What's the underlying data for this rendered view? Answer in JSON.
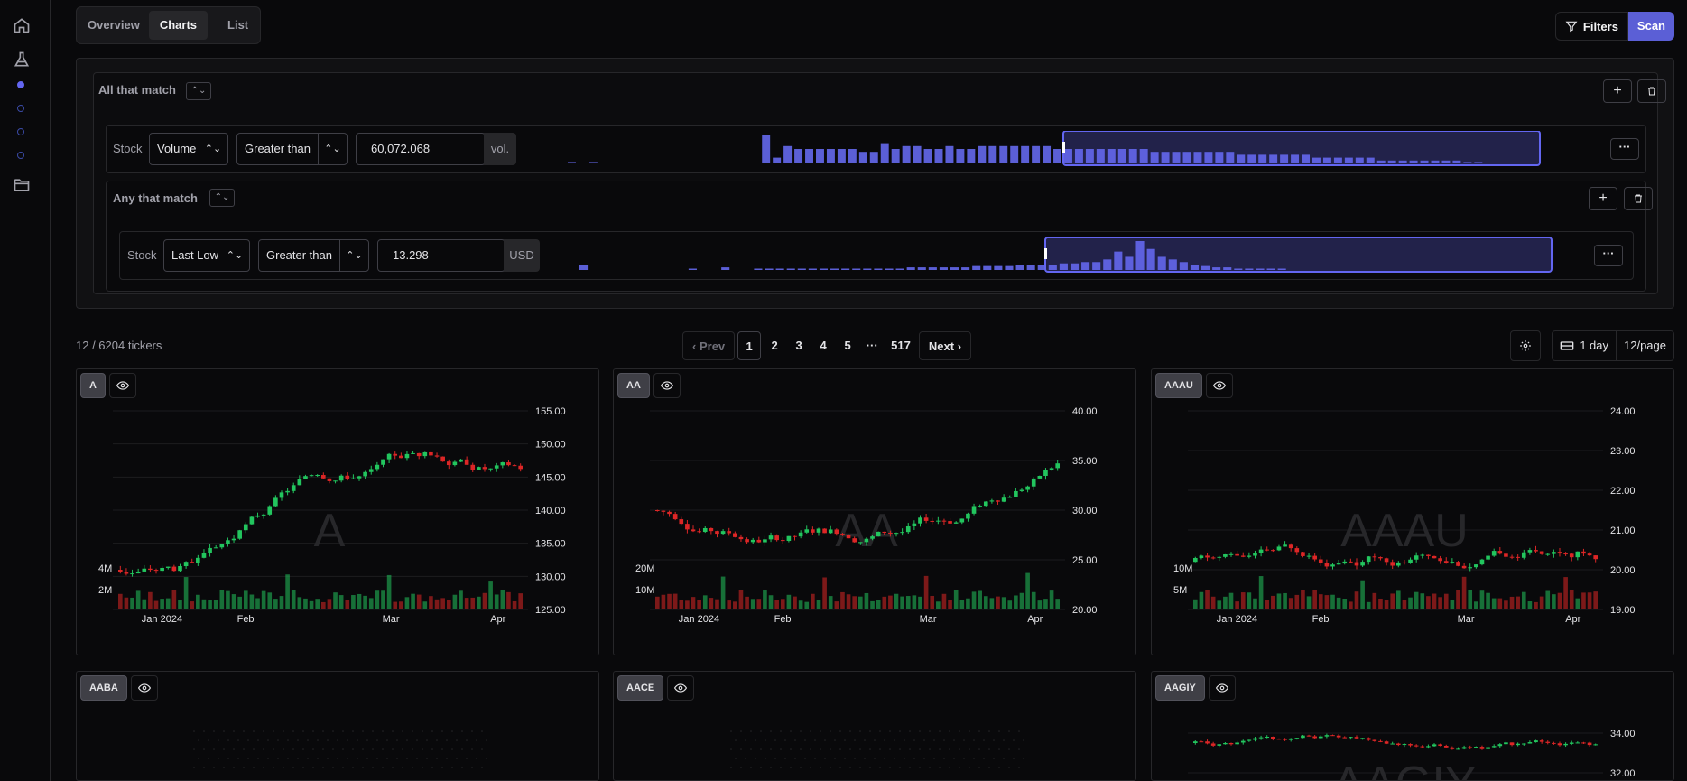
{
  "nav": {
    "icons": [
      "home-icon",
      "flask-icon",
      "folder-icon"
    ]
  },
  "tabs": [
    {
      "label": "Overview",
      "active": false
    },
    {
      "label": "Charts",
      "active": true
    },
    {
      "label": "List",
      "active": false
    }
  ],
  "toolbar": {
    "filters_label": "Filters",
    "scan_label": "Scan"
  },
  "filter_groups": {
    "outer": {
      "title": "All that match"
    },
    "rule1": {
      "scope": "Stock",
      "field": "Volume",
      "operator": "Greater than",
      "value": "60,072.068",
      "unit": "vol."
    },
    "inner": {
      "title": "Any that match"
    },
    "rule2": {
      "scope": "Stock",
      "field": "Last Low",
      "operator": "Greater than",
      "value": "13.298",
      "unit": "USD"
    },
    "hist1": [
      1,
      0,
      1,
      0,
      0,
      0,
      0,
      0,
      0,
      0,
      0,
      0,
      0,
      0,
      0,
      0,
      0,
      0,
      20,
      4,
      12,
      10,
      10,
      10,
      10,
      10,
      10,
      8,
      8,
      14,
      10,
      12,
      12,
      10,
      10,
      12,
      10,
      10,
      12,
      12,
      12,
      12,
      12,
      12,
      12,
      10,
      10,
      10,
      10,
      10,
      10,
      10,
      10,
      10,
      8,
      8,
      8,
      8,
      8,
      8,
      8,
      8,
      6,
      6,
      6,
      6,
      6,
      6,
      6,
      4,
      4,
      4,
      4,
      4,
      4,
      2,
      2,
      2,
      2,
      2,
      2,
      2,
      2,
      1,
      1,
      0,
      0,
      0,
      0,
      0,
      0,
      0
    ],
    "hist2": [
      4,
      0,
      0,
      0,
      0,
      0,
      0,
      0,
      0,
      0,
      1,
      0,
      0,
      2,
      0,
      0,
      1,
      1,
      1,
      1,
      1,
      1,
      1,
      1,
      1,
      1,
      1,
      1,
      1,
      1,
      2,
      2,
      2,
      2,
      2,
      2,
      3,
      3,
      3,
      3,
      4,
      4,
      4,
      4,
      5,
      5,
      6,
      6,
      8,
      14,
      10,
      22,
      16,
      10,
      8,
      6,
      4,
      3,
      2,
      2,
      1,
      1,
      1,
      1,
      1,
      0,
      0,
      0,
      0,
      0,
      0,
      0,
      0,
      0,
      0,
      0,
      0,
      0,
      0,
      0,
      0,
      0,
      0,
      0,
      0,
      0,
      0,
      0,
      0,
      0,
      0
    ],
    "hist1_selection": [
      0.5,
      0.98
    ],
    "hist2_selection": [
      0.47,
      0.98
    ]
  },
  "results": {
    "count_text": "12 / 6204 tickers",
    "prev_label": "Prev",
    "next_label": "Next",
    "pages": [
      "1",
      "2",
      "3",
      "4",
      "5",
      "···",
      "517"
    ],
    "interval_label": "1 day",
    "per_page_label": "12/page"
  },
  "charts": [
    {
      "ticker": "A",
      "y_ticks": [
        "155.00",
        "150.00",
        "145.00",
        "140.00",
        "135.00",
        "130.00",
        "125.00"
      ],
      "ymin": 125,
      "ymax": 155,
      "vol_ticks": [
        "4M",
        "2M"
      ],
      "x_labels": [
        "Jan 2024",
        "Feb",
        "Mar",
        "Apr"
      ],
      "seed": 3,
      "start": 131,
      "trend": [
        0.05,
        0.35,
        0.1,
        -0.05
      ]
    },
    {
      "ticker": "AA",
      "y_ticks": [
        "40.00",
        "35.00",
        "30.00",
        "25.00",
        "20.00"
      ],
      "ymin": 20,
      "ymax": 40,
      "vol_ticks": [
        "20M",
        "10M"
      ],
      "x_labels": [
        "Jan 2024",
        "Feb",
        "Mar",
        "Apr"
      ],
      "seed": 7,
      "start": 30,
      "trend": [
        -0.1,
        0.02,
        0.08,
        0.3
      ]
    },
    {
      "ticker": "AAAU",
      "y_ticks": [
        "24.00",
        "23.00",
        "22.00",
        "21.00",
        "20.00",
        "19.00"
      ],
      "ymin": 19,
      "ymax": 24,
      "vol_ticks": [
        "10M",
        "5M"
      ],
      "x_labels": [
        "Jan 2024",
        "Feb",
        "Mar",
        "Apr"
      ],
      "seed": 11,
      "start": 20.2,
      "trend": [
        -0.02,
        0.04,
        0.03,
        0.1
      ]
    },
    {
      "ticker": "AABA",
      "y_ticks": [],
      "ymin": 0,
      "ymax": 1,
      "vol_ticks": [],
      "x_labels": [],
      "seed": 0,
      "start": 0,
      "trend": []
    },
    {
      "ticker": "AACE",
      "y_ticks": [],
      "ymin": 0,
      "ymax": 1,
      "vol_ticks": [],
      "x_labels": [],
      "seed": 0,
      "start": 0,
      "trend": []
    },
    {
      "ticker": "AAGIY",
      "y_ticks": [
        "34.00",
        "32.00"
      ],
      "ymin": 30,
      "ymax": 35,
      "vol_ticks": [],
      "x_labels": [],
      "seed": 5,
      "start": 33.5,
      "trend": [
        -0.05,
        0.02,
        -0.02,
        -0.05
      ]
    }
  ],
  "colors": {
    "accent": "#6366f1",
    "up": "#22c55e",
    "down": "#dc2626"
  }
}
